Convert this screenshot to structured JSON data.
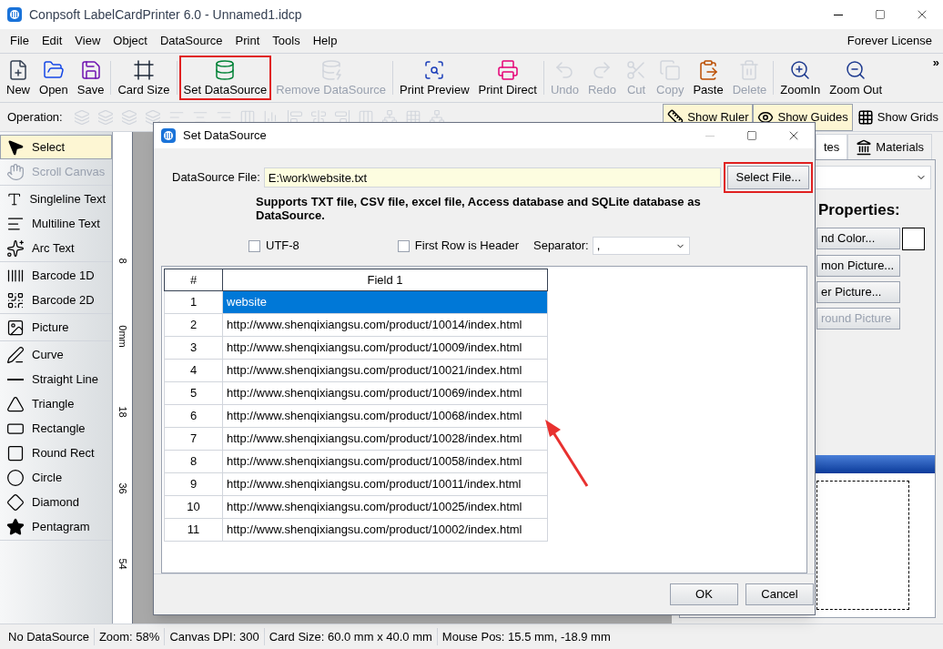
{
  "window": {
    "title": "Conpsoft LabelCardPrinter 6.0 - Unnamed1.idcp"
  },
  "menu": [
    "File",
    "Edit",
    "View",
    "Object",
    "DataSource",
    "Print",
    "Tools",
    "Help"
  ],
  "license": "Forever License",
  "toolbar": [
    {
      "label": "New",
      "disabled": false,
      "highlighted": false
    },
    {
      "label": "Open",
      "disabled": false,
      "highlighted": false
    },
    {
      "label": "Save",
      "disabled": false,
      "highlighted": false
    },
    {
      "label": "Card Size",
      "disabled": false,
      "highlighted": false
    },
    {
      "label": "Set DataSource",
      "disabled": false,
      "highlighted": true
    },
    {
      "label": "Remove DataSource",
      "disabled": true,
      "highlighted": false
    },
    {
      "label": "Print Preview",
      "disabled": false,
      "highlighted": false
    },
    {
      "label": "Print Direct",
      "disabled": false,
      "highlighted": false
    },
    {
      "label": "Undo",
      "disabled": true,
      "highlighted": false
    },
    {
      "label": "Redo",
      "disabled": true,
      "highlighted": false
    },
    {
      "label": "Cut",
      "disabled": true,
      "highlighted": false
    },
    {
      "label": "Copy",
      "disabled": true,
      "highlighted": false
    },
    {
      "label": "Paste",
      "disabled": false,
      "highlighted": false
    },
    {
      "label": "Delete",
      "disabled": true,
      "highlighted": false
    },
    {
      "label": "ZoomIn",
      "disabled": false,
      "highlighted": false
    },
    {
      "label": "Zoom Out",
      "disabled": false,
      "highlighted": false
    }
  ],
  "toolbar_overflow": "»",
  "operation_label": "Operation:",
  "view_toggles": [
    {
      "label": "Show Ruler",
      "on": true
    },
    {
      "label": "Show Guides",
      "on": true
    },
    {
      "label": "Show Grids",
      "on": false
    }
  ],
  "tool_groups": [
    {
      "items": [
        {
          "label": "Select",
          "selected": true,
          "disabled": false
        },
        {
          "label": "Scroll Canvas",
          "selected": false,
          "disabled": true
        }
      ]
    },
    {
      "items": [
        {
          "label": "Singleline Text",
          "selected": false,
          "disabled": false
        },
        {
          "label": "Multiline Text",
          "selected": false,
          "disabled": false
        },
        {
          "label": "Arc Text",
          "selected": false,
          "disabled": false
        }
      ]
    },
    {
      "items": [
        {
          "label": "Barcode 1D",
          "selected": false,
          "disabled": false
        },
        {
          "label": "Barcode 2D",
          "selected": false,
          "disabled": false
        }
      ]
    },
    {
      "items": [
        {
          "label": "Picture",
          "selected": false,
          "disabled": false
        }
      ]
    },
    {
      "items": [
        {
          "label": "Curve",
          "selected": false,
          "disabled": false
        },
        {
          "label": "Straight Line",
          "selected": false,
          "disabled": false
        },
        {
          "label": "Triangle",
          "selected": false,
          "disabled": false
        },
        {
          "label": "Rectangle",
          "selected": false,
          "disabled": false
        },
        {
          "label": "Round Rect",
          "selected": false,
          "disabled": false
        },
        {
          "label": "Circle",
          "selected": false,
          "disabled": false
        },
        {
          "label": "Diamond",
          "selected": false,
          "disabled": false
        },
        {
          "label": "Pentagram",
          "selected": false,
          "disabled": false
        }
      ]
    }
  ],
  "ruler_labels": [
    "8",
    "0mm",
    "18",
    "36",
    "54"
  ],
  "right_panel": {
    "tabs": [
      {
        "label": "tes",
        "selected": true
      },
      {
        "label": "Materials",
        "selected": false
      }
    ],
    "heading": "Properties:",
    "buttons": [
      {
        "label": "nd Color...",
        "disabled": false
      },
      {
        "label": "mon Picture...",
        "disabled": false
      },
      {
        "label": "er Picture...",
        "disabled": false
      },
      {
        "label": "round Picture",
        "disabled": true
      }
    ]
  },
  "dialog": {
    "title": "Set DataSource",
    "file_label": "DataSource File:",
    "file_value": "E:\\work\\website.txt",
    "select_button": {
      "label": "Select File...",
      "highlighted": true
    },
    "note": "Supports TXT file, CSV file, excel file, Access database and SQLite database as DataSource.",
    "options": [
      {
        "label": "UTF-8",
        "checked": false
      },
      {
        "label": "First Row is Header",
        "checked": false
      }
    ],
    "separator": {
      "label": "Separator:",
      "value": ","
    },
    "table": {
      "columns": [
        "#",
        "Field 1"
      ],
      "rows": [
        {
          "cells": [
            "1",
            "website"
          ],
          "selected": true
        },
        {
          "cells": [
            "2",
            "http://www.shenqixiangsu.com/product/10014/index.html"
          ],
          "selected": false
        },
        {
          "cells": [
            "3",
            "http://www.shenqixiangsu.com/product/10009/index.html"
          ],
          "selected": false
        },
        {
          "cells": [
            "4",
            "http://www.shenqixiangsu.com/product/10021/index.html"
          ],
          "selected": false
        },
        {
          "cells": [
            "5",
            "http://www.shenqixiangsu.com/product/10069/index.html"
          ],
          "selected": false
        },
        {
          "cells": [
            "6",
            "http://www.shenqixiangsu.com/product/10068/index.html"
          ],
          "selected": false
        },
        {
          "cells": [
            "7",
            "http://www.shenqixiangsu.com/product/10028/index.html"
          ],
          "selected": false
        },
        {
          "cells": [
            "8",
            "http://www.shenqixiangsu.com/product/10058/index.html"
          ],
          "selected": false
        },
        {
          "cells": [
            "9",
            "http://www.shenqixiangsu.com/product/10011/index.html"
          ],
          "selected": false
        },
        {
          "cells": [
            "10",
            "http://www.shenqixiangsu.com/product/10025/index.html"
          ],
          "selected": false
        },
        {
          "cells": [
            "11",
            "http://www.shenqixiangsu.com/product/10002/index.html"
          ],
          "selected": false
        }
      ]
    },
    "buttons": [
      "OK",
      "Cancel"
    ]
  },
  "status_bar": [
    "No DataSource",
    "Zoom: 58%",
    "Canvas DPI: 300",
    "Card Size: 60.0 mm x 40.0 mm",
    "Mouse Pos: 15.5 mm, -18.9 mm"
  ]
}
